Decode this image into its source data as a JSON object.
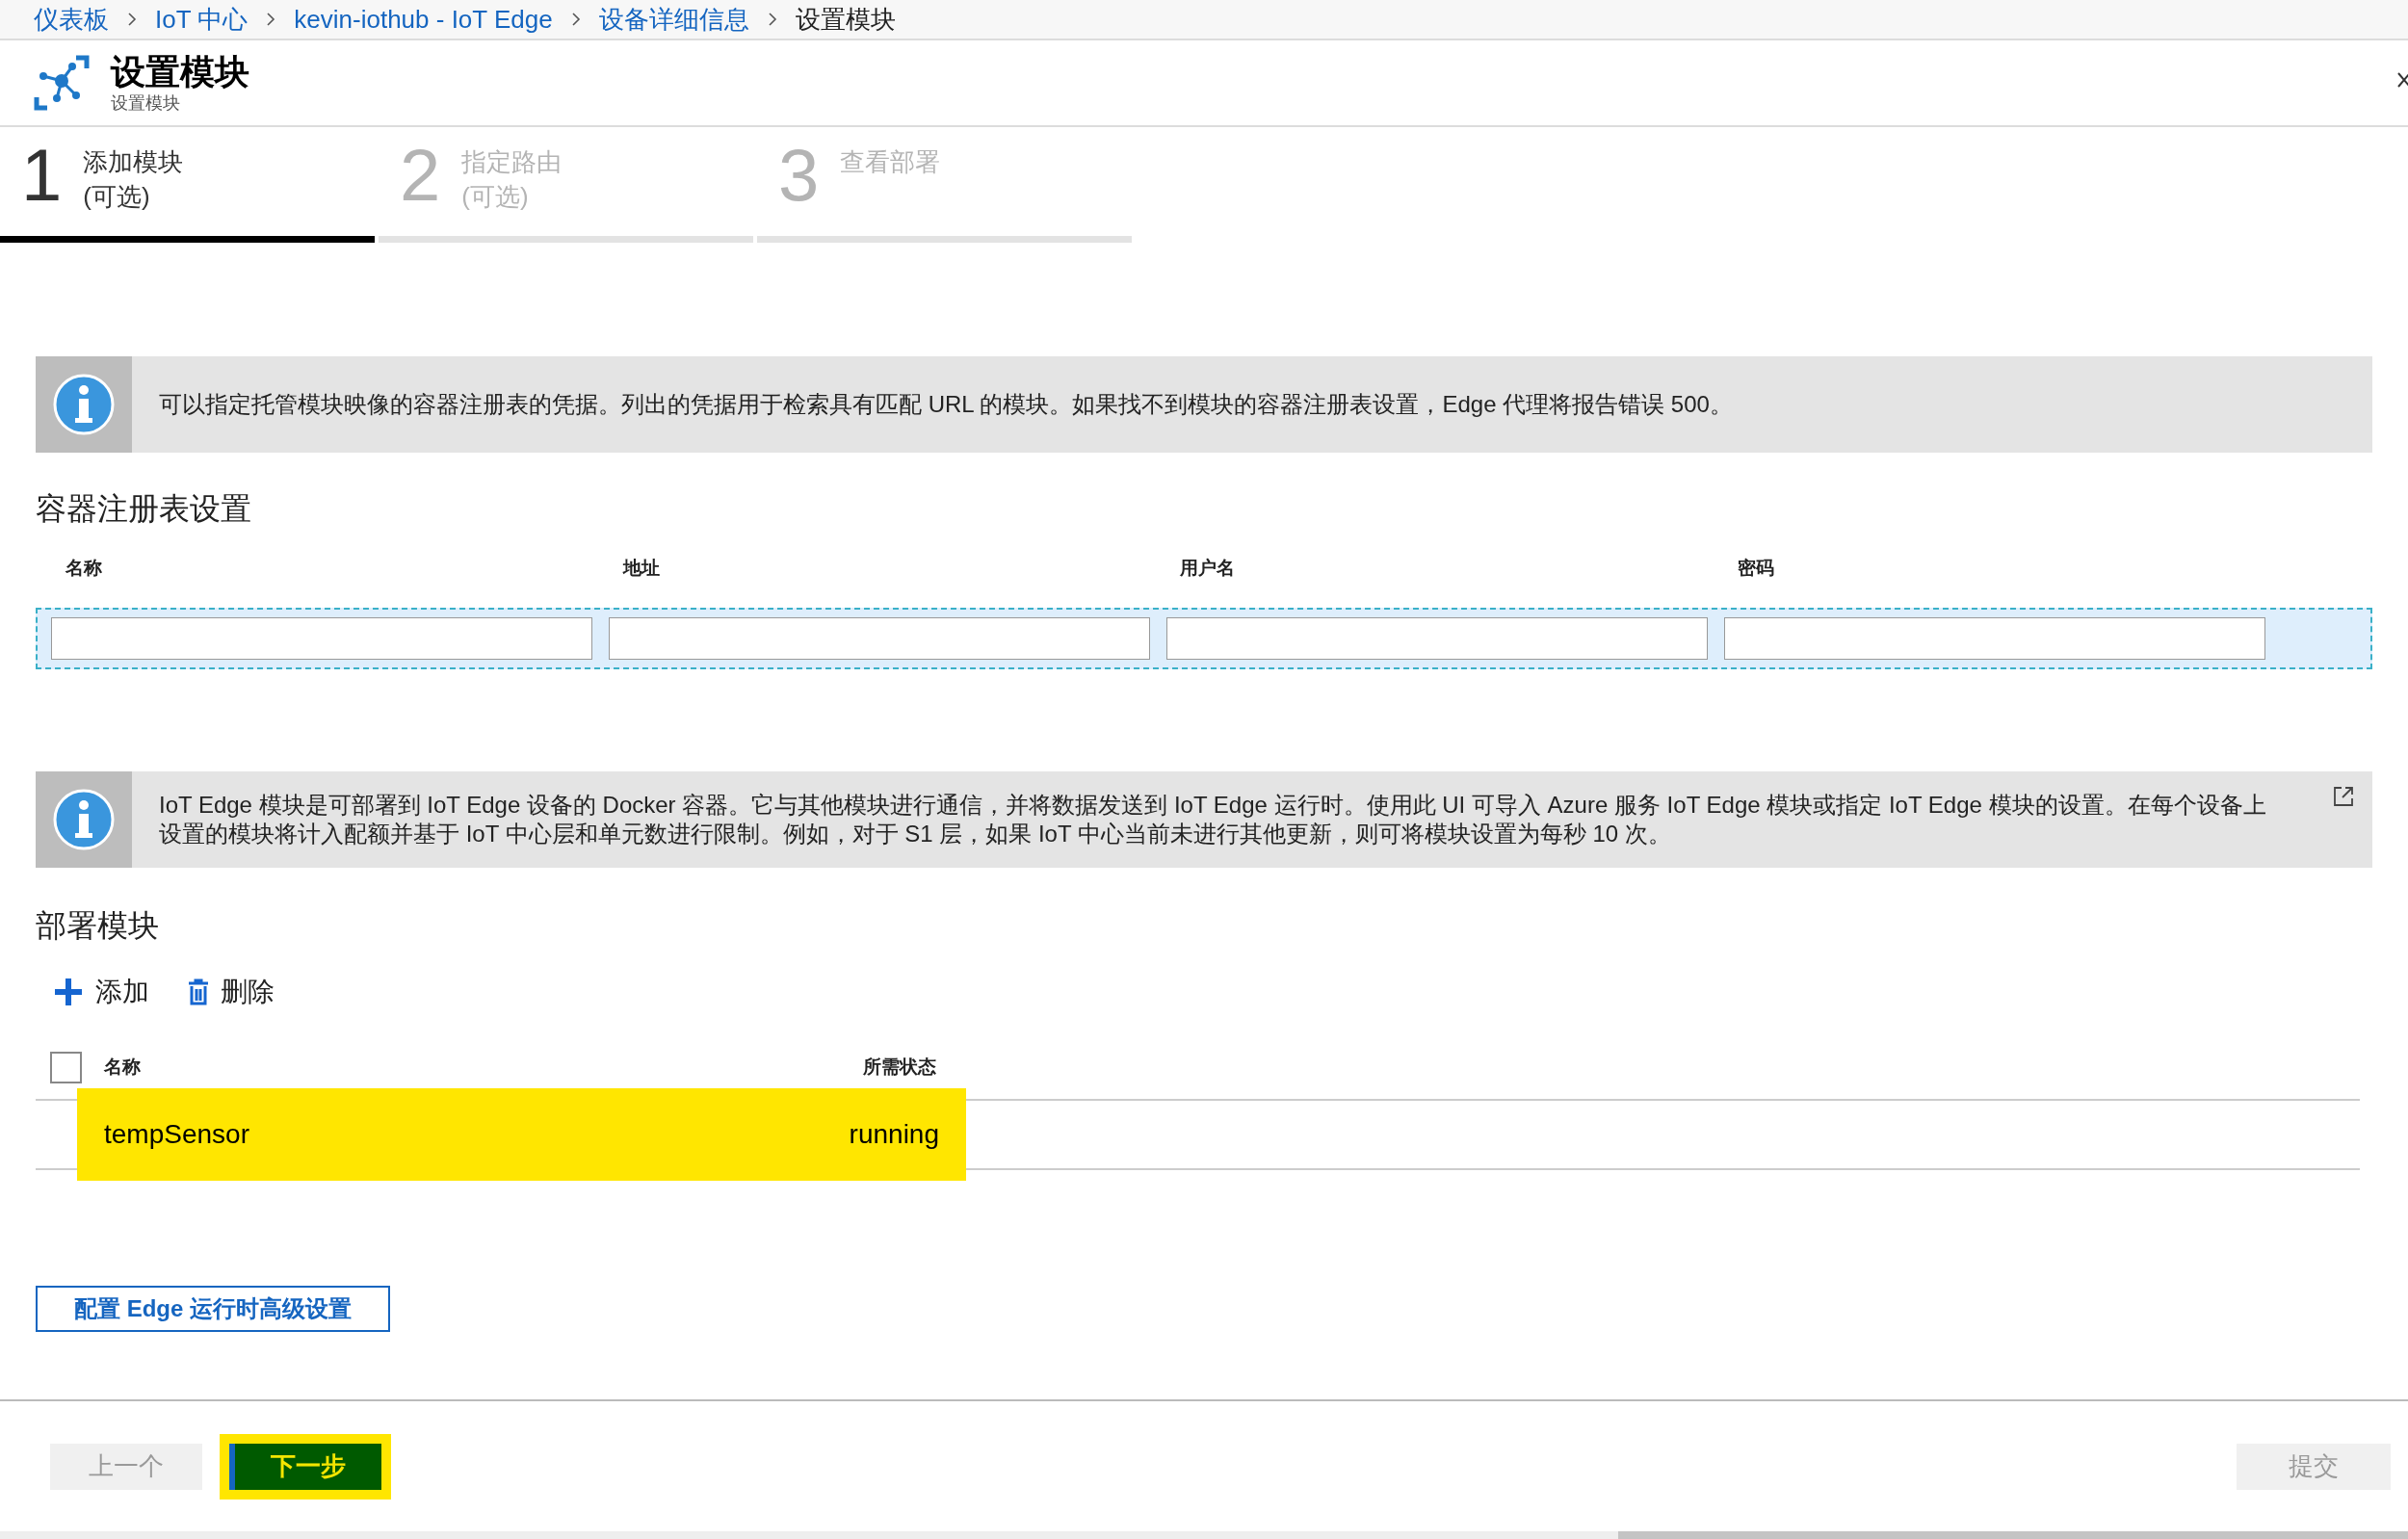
{
  "breadcrumb": [
    {
      "label": "仪表板",
      "kind": "link"
    },
    {
      "label": "IoT 中心",
      "kind": "link"
    },
    {
      "label": "kevin-iothub - IoT Edge",
      "kind": "link"
    },
    {
      "label": "设备详细信息",
      "kind": "link"
    },
    {
      "label": "设置模块",
      "kind": "current"
    }
  ],
  "blade": {
    "title": "设置模块",
    "subtitle": "设置模块"
  },
  "steps": [
    {
      "number": "1",
      "label": "添加模块",
      "note": "(可选)",
      "selected": true
    },
    {
      "number": "2",
      "label": "指定路由",
      "note": "(可选)",
      "selected": false
    },
    {
      "number": "3",
      "label": "查看部署",
      "selected": false
    }
  ],
  "registry_info": "可以指定托管模块映像的容器注册表的凭据。列出的凭据用于检索具有匹配 URL 的模块。如果找不到模块的容器注册表设置，Edge 代理将报告错误 500。",
  "registry": {
    "title": "容器注册表设置",
    "columns": [
      "名称",
      "地址",
      "用户名",
      "密码"
    ]
  },
  "modules_info": "IoT Edge 模块是可部署到 IoT Edge 设备的 Docker 容器。它与其他模块进行通信，并将数据发送到 IoT Edge 运行时。使用此 UI 可导入 Azure 服务 IoT Edge 模块或指定 IoT Edge 模块的设置。在每个设备上设置的模块将计入配额并基于 IoT 中心层和单元数进行限制。例如，对于 S1 层，如果 IoT 中心当前未进行其他更新，则可将模块设置为每秒 10 次。",
  "modules": {
    "title": "部署模块",
    "toolbar": [
      {
        "label": "添加",
        "kind": "add"
      },
      {
        "label": "删除",
        "kind": "delete"
      }
    ],
    "columns": [
      "名称",
      "所需状态"
    ],
    "select_all_checked": false,
    "rows": [
      {
        "name": "tempSensor",
        "status": "running",
        "highlighted": true
      }
    ]
  },
  "advanced_button": "配置 Edge 运行时高级设置",
  "footer": {
    "nav": [
      {
        "label": "上一个",
        "kind": "secondary",
        "disabled": true,
        "highlighted": false
      },
      {
        "label": "下一步",
        "kind": "primary",
        "highlighted": true
      }
    ],
    "submit": {
      "label": "提交",
      "disabled": true
    }
  }
}
